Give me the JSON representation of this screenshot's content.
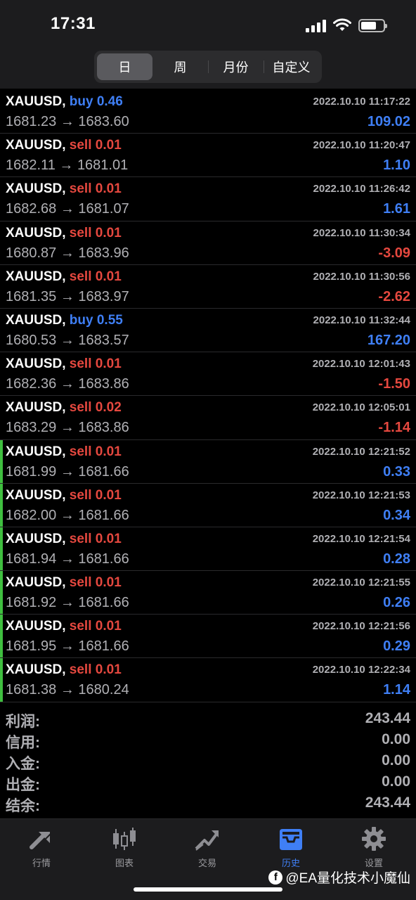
{
  "status": {
    "time": "17:31"
  },
  "period_tabs": [
    {
      "label": "日",
      "active": true
    },
    {
      "label": "周",
      "active": false
    },
    {
      "label": "月份",
      "active": false
    },
    {
      "label": "自定义",
      "active": false
    }
  ],
  "trades": [
    {
      "symbol": "XAUUSD,",
      "side": "buy",
      "volume": "0.46",
      "open": "1681.23",
      "close": "1683.60",
      "time": "2022.10.10 11:17:22",
      "profit": "109.02",
      "sign": "pos",
      "marked": false
    },
    {
      "symbol": "XAUUSD,",
      "side": "sell",
      "volume": "0.01",
      "open": "1682.11",
      "close": "1681.01",
      "time": "2022.10.10 11:20:47",
      "profit": "1.10",
      "sign": "pos",
      "marked": false
    },
    {
      "symbol": "XAUUSD,",
      "side": "sell",
      "volume": "0.01",
      "open": "1682.68",
      "close": "1681.07",
      "time": "2022.10.10 11:26:42",
      "profit": "1.61",
      "sign": "pos",
      "marked": false
    },
    {
      "symbol": "XAUUSD,",
      "side": "sell",
      "volume": "0.01",
      "open": "1680.87",
      "close": "1683.96",
      "time": "2022.10.10 11:30:34",
      "profit": "-3.09",
      "sign": "neg",
      "marked": false
    },
    {
      "symbol": "XAUUSD,",
      "side": "sell",
      "volume": "0.01",
      "open": "1681.35",
      "close": "1683.97",
      "time": "2022.10.10 11:30:56",
      "profit": "-2.62",
      "sign": "neg",
      "marked": false
    },
    {
      "symbol": "XAUUSD,",
      "side": "buy",
      "volume": "0.55",
      "open": "1680.53",
      "close": "1683.57",
      "time": "2022.10.10 11:32:44",
      "profit": "167.20",
      "sign": "pos",
      "marked": false
    },
    {
      "symbol": "XAUUSD,",
      "side": "sell",
      "volume": "0.01",
      "open": "1682.36",
      "close": "1683.86",
      "time": "2022.10.10 12:01:43",
      "profit": "-1.50",
      "sign": "neg",
      "marked": false
    },
    {
      "symbol": "XAUUSD,",
      "side": "sell",
      "volume": "0.02",
      "open": "1683.29",
      "close": "1683.86",
      "time": "2022.10.10 12:05:01",
      "profit": "-1.14",
      "sign": "neg",
      "marked": false
    },
    {
      "symbol": "XAUUSD,",
      "side": "sell",
      "volume": "0.01",
      "open": "1681.99",
      "close": "1681.66",
      "time": "2022.10.10 12:21:52",
      "profit": "0.33",
      "sign": "pos",
      "marked": true
    },
    {
      "symbol": "XAUUSD,",
      "side": "sell",
      "volume": "0.01",
      "open": "1682.00",
      "close": "1681.66",
      "time": "2022.10.10 12:21:53",
      "profit": "0.34",
      "sign": "pos",
      "marked": true
    },
    {
      "symbol": "XAUUSD,",
      "side": "sell",
      "volume": "0.01",
      "open": "1681.94",
      "close": "1681.66",
      "time": "2022.10.10 12:21:54",
      "profit": "0.28",
      "sign": "pos",
      "marked": true
    },
    {
      "symbol": "XAUUSD,",
      "side": "sell",
      "volume": "0.01",
      "open": "1681.92",
      "close": "1681.66",
      "time": "2022.10.10 12:21:55",
      "profit": "0.26",
      "sign": "pos",
      "marked": true
    },
    {
      "symbol": "XAUUSD,",
      "side": "sell",
      "volume": "0.01",
      "open": "1681.95",
      "close": "1681.66",
      "time": "2022.10.10 12:21:56",
      "profit": "0.29",
      "sign": "pos",
      "marked": true
    },
    {
      "symbol": "XAUUSD,",
      "side": "sell",
      "volume": "0.01",
      "open": "1681.38",
      "close": "1680.24",
      "time": "2022.10.10 12:22:34",
      "profit": "1.14",
      "sign": "pos",
      "marked": true
    }
  ],
  "summary": {
    "profit_label": "利润:",
    "profit_value": "243.44",
    "credit_label": "信用:",
    "credit_value": "0.00",
    "deposit_label": "入金:",
    "deposit_value": "0.00",
    "withdrawal_label": "出金:",
    "withdrawal_value": "0.00",
    "balance_label": "结余:",
    "balance_value": "243.44"
  },
  "tabbar": [
    {
      "label": "行情",
      "icon": "quotes-arrows-icon",
      "active": false
    },
    {
      "label": "图表",
      "icon": "candlestick-chart-icon",
      "active": false
    },
    {
      "label": "交易",
      "icon": "trade-trend-icon",
      "active": false
    },
    {
      "label": "历史",
      "icon": "history-inbox-icon",
      "active": true
    },
    {
      "label": "设置",
      "icon": "gear-icon",
      "active": false
    }
  ],
  "watermark": "@EA量化技术小魔仙",
  "colors": {
    "buy": "#3f7ff5",
    "sell": "#e5483f",
    "marker": "#3fbf3f",
    "active_tab": "#3f7ff5"
  }
}
